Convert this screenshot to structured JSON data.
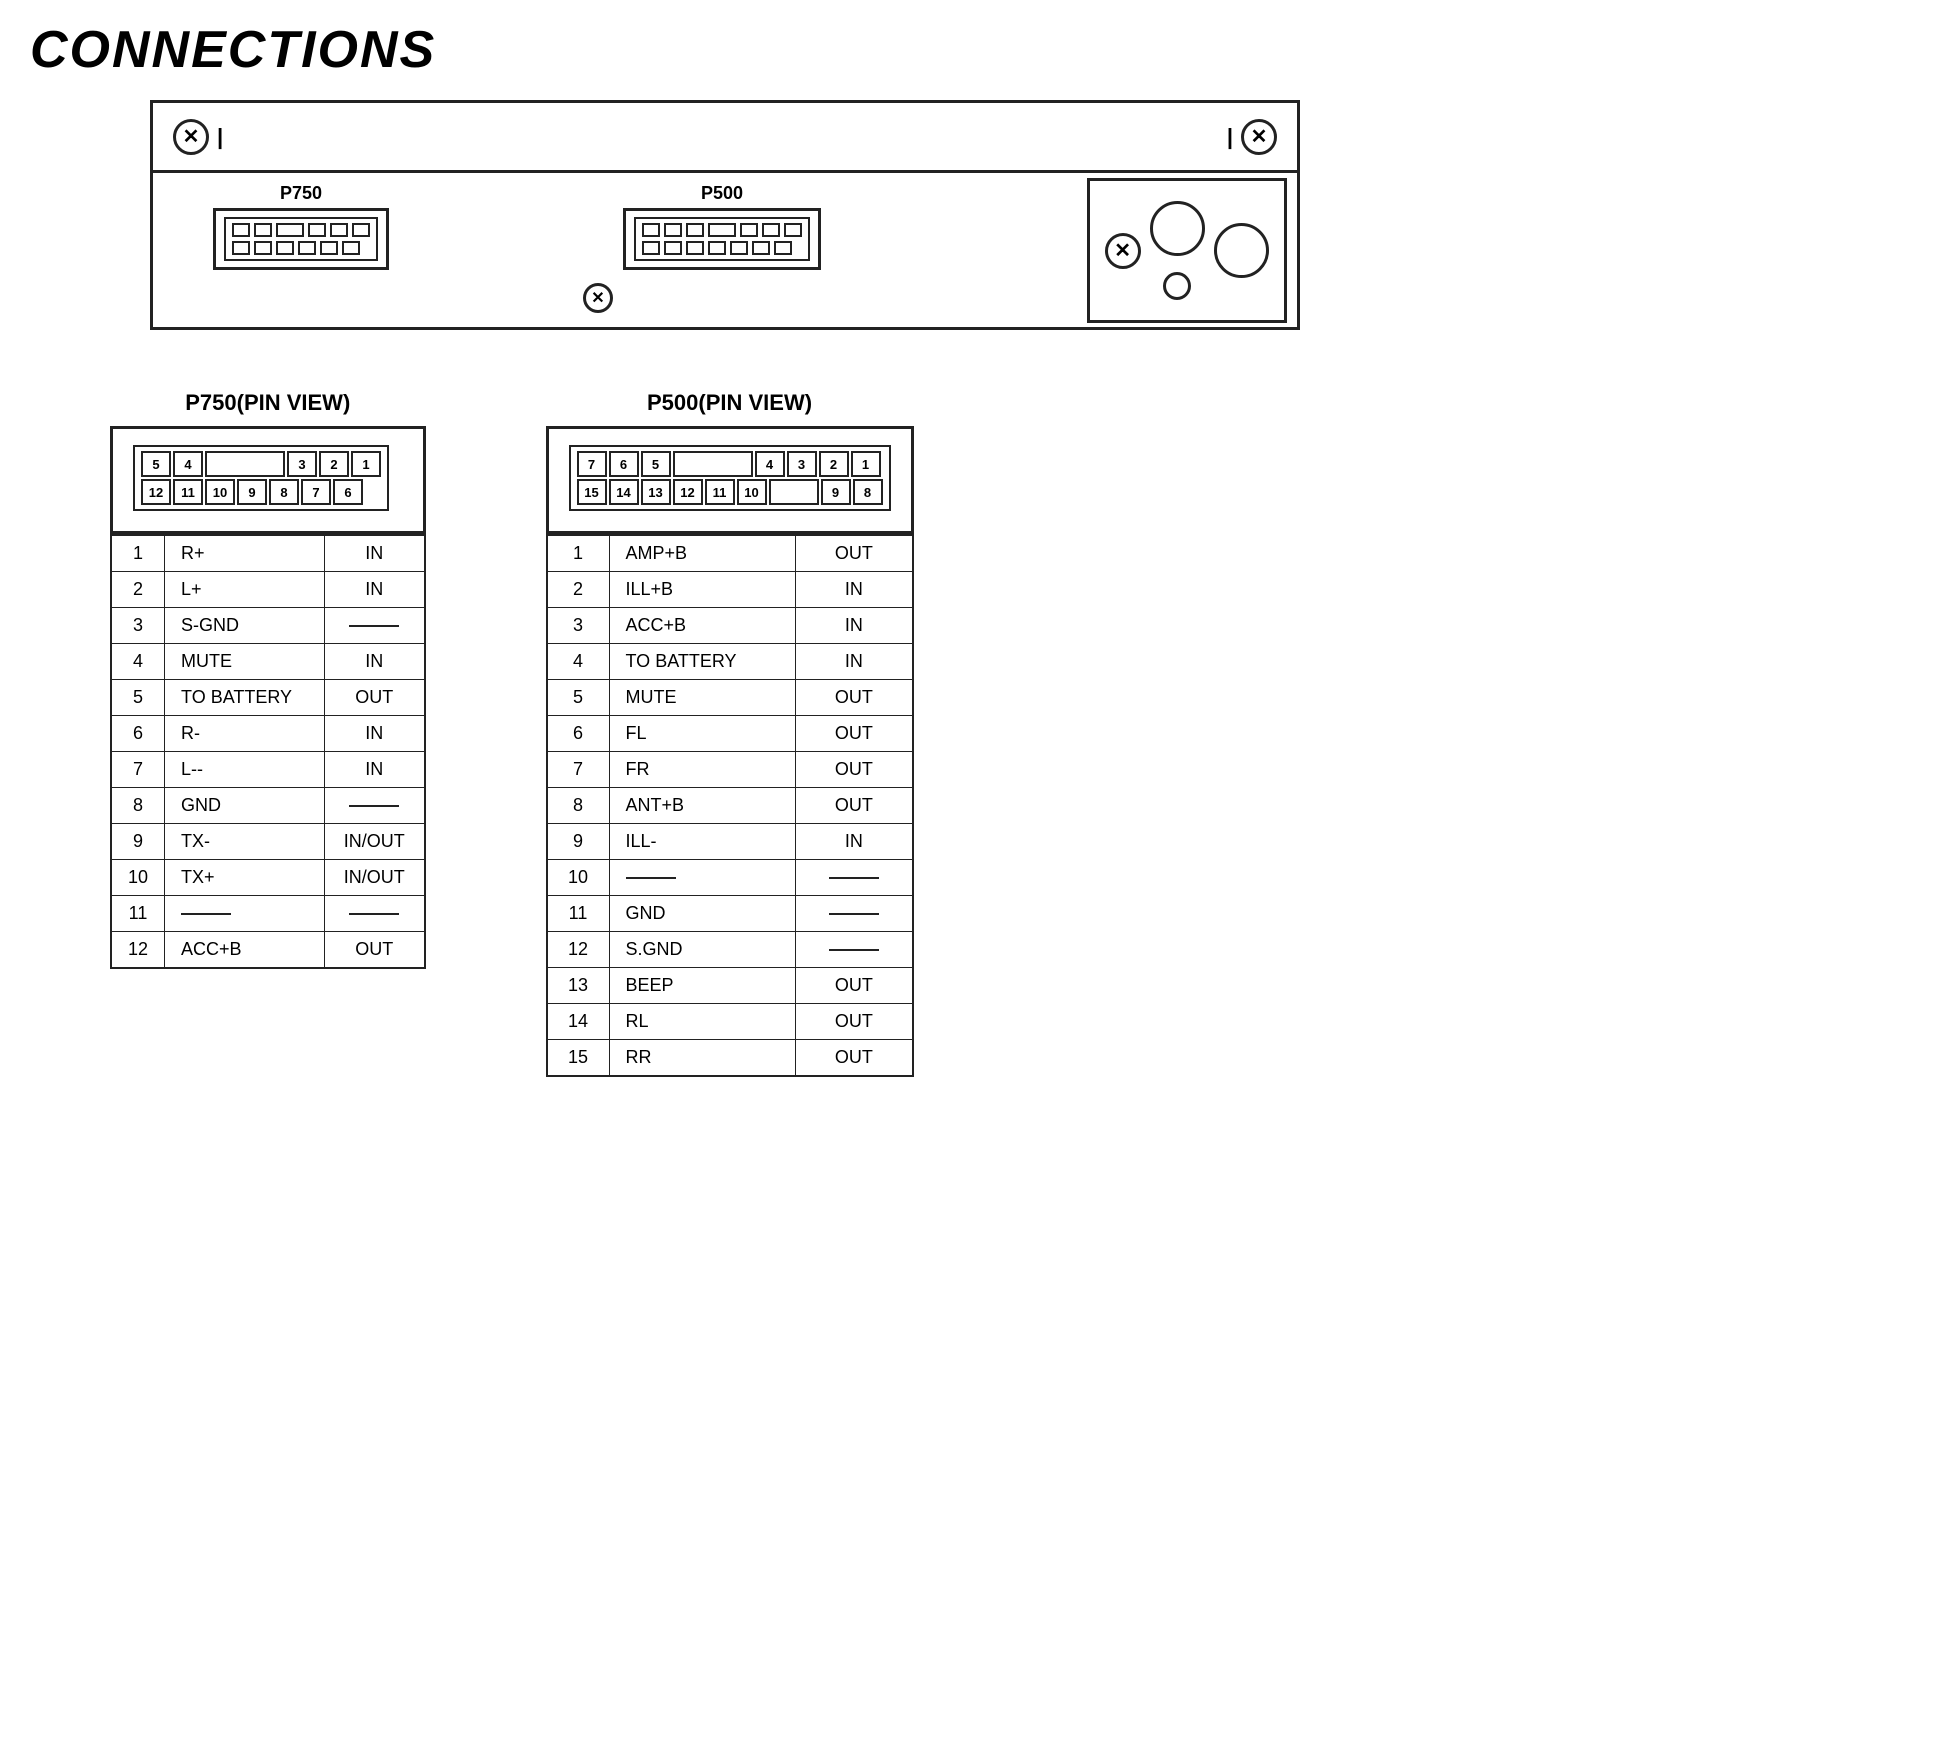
{
  "page": {
    "title": "CONNECTIONS"
  },
  "connectors": {
    "p750_label": "P750",
    "p500_label": "P500",
    "p750_pin_title": "P750(PIN VIEW)",
    "p500_pin_title": "P500(PIN VIEW)"
  },
  "p750_pins": [
    {
      "num": "1",
      "signal": "R+",
      "dir": "IN"
    },
    {
      "num": "2",
      "signal": "L+",
      "dir": "IN"
    },
    {
      "num": "3",
      "signal": "S-GND",
      "dir": "—"
    },
    {
      "num": "4",
      "signal": "MUTE",
      "dir": "IN"
    },
    {
      "num": "5",
      "signal": "TO BATTERY",
      "dir": "OUT"
    },
    {
      "num": "6",
      "signal": "R-",
      "dir": "IN"
    },
    {
      "num": "7",
      "signal": "L--",
      "dir": "IN"
    },
    {
      "num": "8",
      "signal": "GND",
      "dir": "—"
    },
    {
      "num": "9",
      "signal": "TX-",
      "dir": "IN/OUT"
    },
    {
      "num": "10",
      "signal": "TX+",
      "dir": "IN/OUT"
    },
    {
      "num": "11",
      "signal": "—",
      "dir": "—"
    },
    {
      "num": "12",
      "signal": "ACC+B",
      "dir": "OUT"
    }
  ],
  "p500_pins": [
    {
      "num": "1",
      "signal": "AMP+B",
      "dir": "OUT"
    },
    {
      "num": "2",
      "signal": "ILL+B",
      "dir": "IN"
    },
    {
      "num": "3",
      "signal": "ACC+B",
      "dir": "IN"
    },
    {
      "num": "4",
      "signal": "TO BATTERY",
      "dir": "IN"
    },
    {
      "num": "5",
      "signal": "MUTE",
      "dir": "OUT"
    },
    {
      "num": "6",
      "signal": "FL",
      "dir": "OUT"
    },
    {
      "num": "7",
      "signal": "FR",
      "dir": "OUT"
    },
    {
      "num": "8",
      "signal": "ANT+B",
      "dir": "OUT"
    },
    {
      "num": "9",
      "signal": "ILL-",
      "dir": "IN"
    },
    {
      "num": "10",
      "signal": "—",
      "dir": "—"
    },
    {
      "num": "11",
      "signal": "GND",
      "dir": "—"
    },
    {
      "num": "12",
      "signal": "S.GND",
      "dir": "—"
    },
    {
      "num": "13",
      "signal": "BEEP",
      "dir": "OUT"
    },
    {
      "num": "14",
      "signal": "RL",
      "dir": "OUT"
    },
    {
      "num": "15",
      "signal": "RR",
      "dir": "OUT"
    }
  ]
}
